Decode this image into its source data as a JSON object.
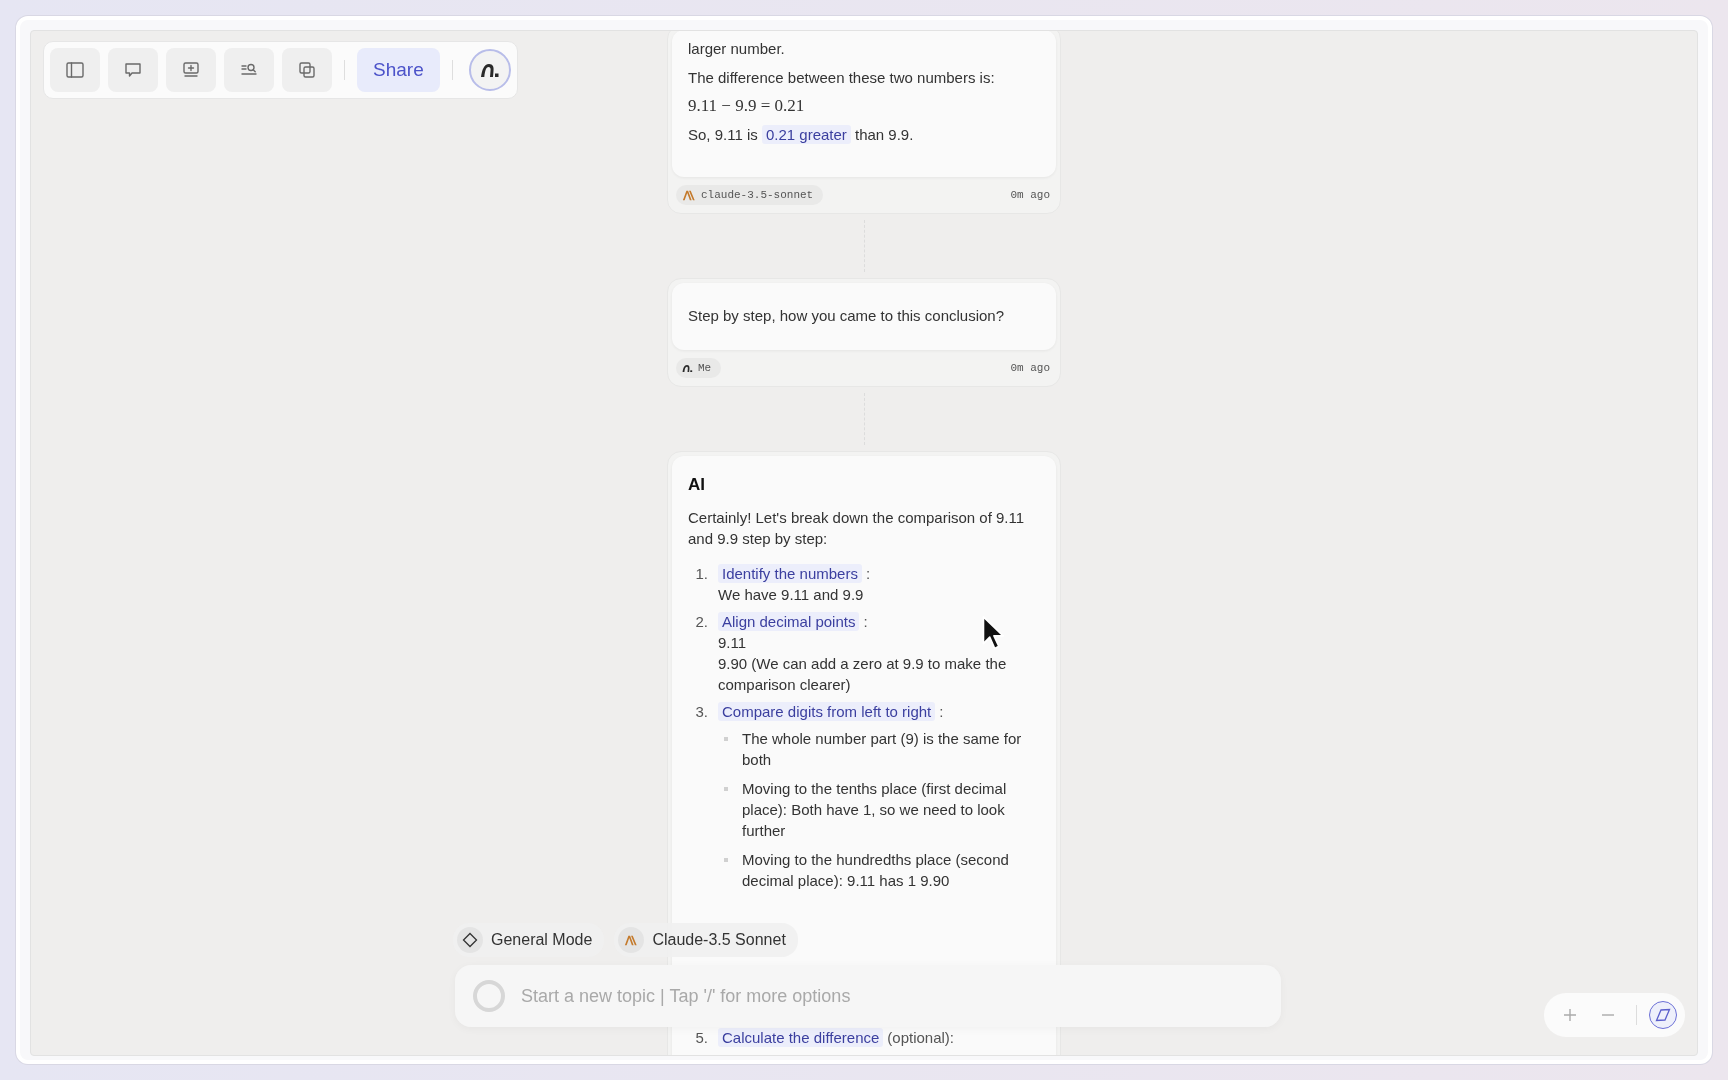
{
  "toolbar": {
    "share_label": "Share"
  },
  "messages": [
    {
      "kind": "assistant",
      "blocks": [
        {
          "kind": "text",
          "text": "larger number."
        },
        {
          "kind": "text",
          "text": "The difference between these two numbers is:"
        },
        {
          "kind": "math",
          "text": "9.11 − 9.9 = 0.21"
        },
        {
          "kind": "highlight",
          "before": "So, 9.11 is",
          "highlight": "0.21 greater",
          "after": "than 9.9."
        }
      ],
      "author": "claude-3.5-sonnet",
      "time": "0m ago"
    },
    {
      "kind": "user",
      "blocks": [
        {
          "kind": "text",
          "text": "Step by step, how you came to this conclusion?"
        }
      ],
      "author": "Me",
      "time": "0m ago"
    },
    {
      "kind": "assistant",
      "heading": "AI",
      "blocks": [
        {
          "kind": "text",
          "text": "Certainly! Let's break down the comparison of 9.11 and 9.9 step by step:"
        },
        {
          "kind": "steps",
          "items": [
            {
              "number": "1.",
              "label": "Identify the numbers",
              "suffix": ":",
              "lines": [
                "We have 9.11 and 9.9"
              ]
            },
            {
              "number": "2.",
              "label": "Align decimal points",
              "suffix": ":",
              "lines": [
                "9.11",
                "9.90 (We can add a zero at 9.9 to make the comparison clearer)"
              ]
            },
            {
              "number": "3.",
              "label": "Compare digits from left to right",
              "suffix": ":",
              "bullets": [
                "The whole number part (9) is the same for both",
                "Moving to the tenths place (first decimal place): Both have 1, so we need to look further",
                "Moving to the hundredths place (second decimal place): 9.11 has 1 9.90"
              ]
            },
            {
              "number": "5.",
              "label": "Calculate the difference",
              "suffix": "(optional):"
            }
          ]
        }
      ]
    }
  ],
  "chips": [
    {
      "kind": "mode",
      "label": "General Mode"
    },
    {
      "kind": "model",
      "label": "Claude-3.5 Sonnet"
    }
  ],
  "prompt": {
    "placeholder": "Start a new topic | Tap '/' for more options"
  }
}
